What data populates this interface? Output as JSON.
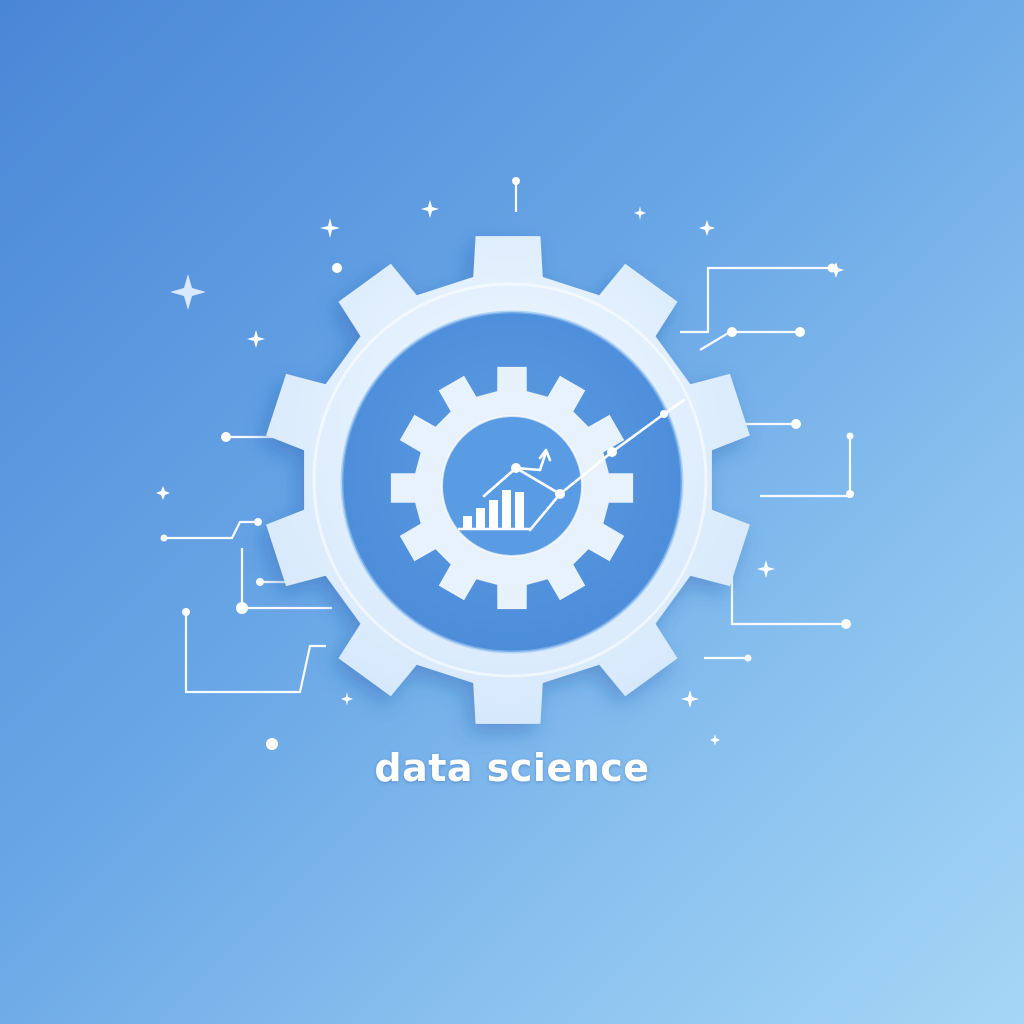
{
  "logo": {
    "caption": "data science",
    "icons": [
      "gear-icon",
      "inner-gear-icon",
      "bar-chart-icon",
      "trend-line-icon",
      "circuit-traces",
      "sparkle-icon"
    ]
  },
  "colors": {
    "background_start": "#4a86d6",
    "background_end": "#a6d6f6",
    "gear_light": "#e6f2fd",
    "gear_inner": "#6aa8e8",
    "line": "#ffffff"
  }
}
